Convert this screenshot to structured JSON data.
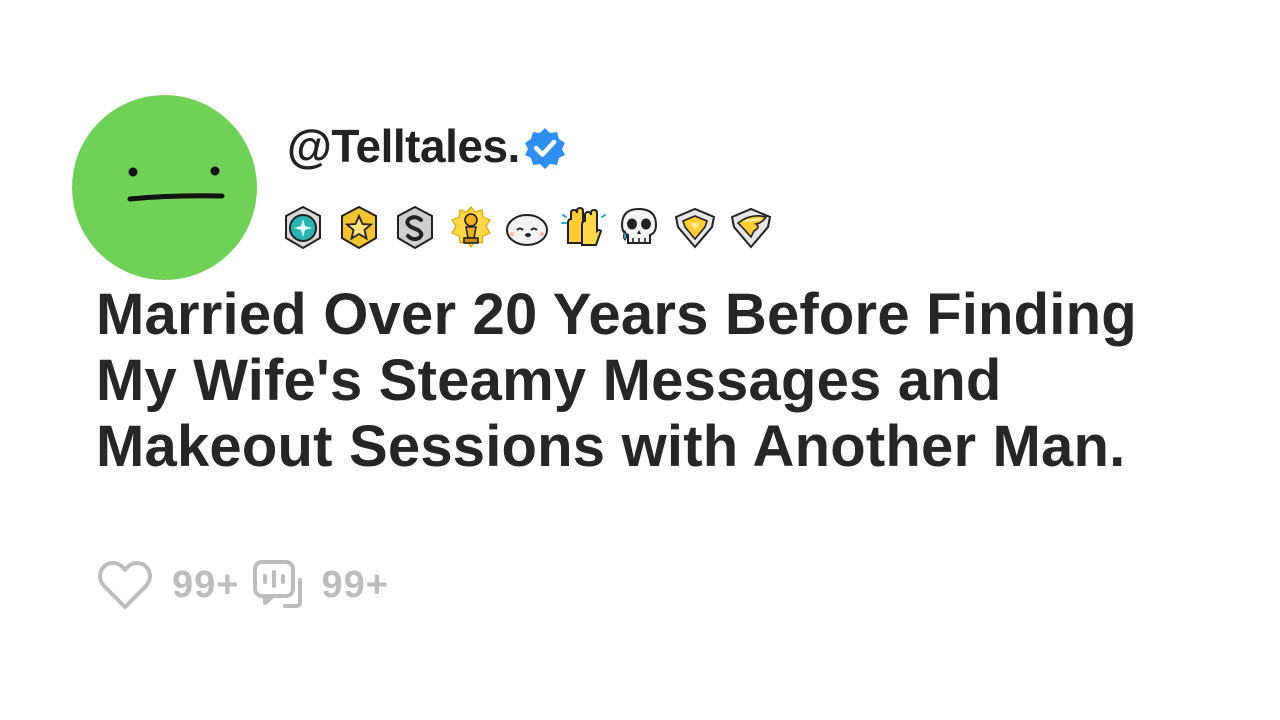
{
  "post": {
    "author": {
      "username": "@Telltales.",
      "verified": true,
      "avatar_color": "#6fd157"
    },
    "badges": [
      {
        "icon": "teal-gem-award-icon"
      },
      {
        "icon": "gold-star-award-icon"
      },
      {
        "icon": "silver-s-award-icon"
      },
      {
        "icon": "gold-trophy-award-icon"
      },
      {
        "icon": "seal-award-icon"
      },
      {
        "icon": "high-five-hands-award-icon"
      },
      {
        "icon": "crying-skull-award-icon"
      },
      {
        "icon": "gold-heart-shield-award-icon"
      },
      {
        "icon": "gold-wing-shield-award-icon"
      }
    ],
    "title": "Married Over 20 Years Before Finding My Wife's Steamy Messages and Makeout Sessions with Another Man.",
    "likes": "99+",
    "comments": "99+"
  },
  "colors": {
    "text": "#262626",
    "muted": "#bdbdbd",
    "verified_blue": "#2f8ff0",
    "avatar": "#6fd157"
  }
}
